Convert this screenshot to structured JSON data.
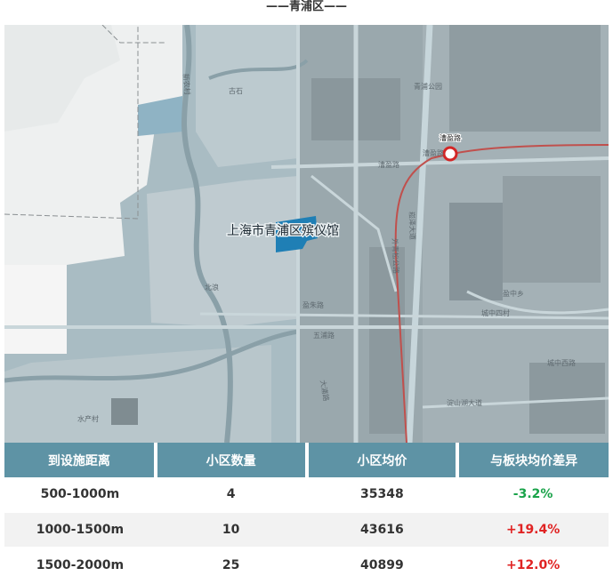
{
  "title": "——青浦区——",
  "map": {
    "poi_label": "上海市青浦区殡仪馆",
    "station_label": "漕盈路",
    "place_labels": [
      "古石",
      "北浪",
      "水产村",
      "盈中乡",
      "城中西路",
      "漕盈路",
      "淀山湖大道",
      "青浦公园",
      "漕盈路",
      "盈朱路",
      "五浦路",
      "大浦路",
      "外青松公路",
      "崧泽大道",
      "新农村",
      "城中四村"
    ],
    "colors": {
      "water": "#a9bcc3",
      "land": "#c5d1d5",
      "urban": "#8f9da3",
      "metro_line": "#c0504d"
    }
  },
  "table": {
    "headers": [
      "到设施距离",
      "小区数量",
      "小区均价",
      "与板块均价差异"
    ],
    "rows": [
      {
        "distance": "500-1000m",
        "count": "4",
        "price": "35348",
        "diff": "-3.2%",
        "trend": "neg"
      },
      {
        "distance": "1000-1500m",
        "count": "10",
        "price": "43616",
        "diff": "+19.4%",
        "trend": "pos"
      },
      {
        "distance": "1500-2000m",
        "count": "25",
        "price": "40899",
        "diff": "+12.0%",
        "trend": "pos"
      }
    ]
  }
}
